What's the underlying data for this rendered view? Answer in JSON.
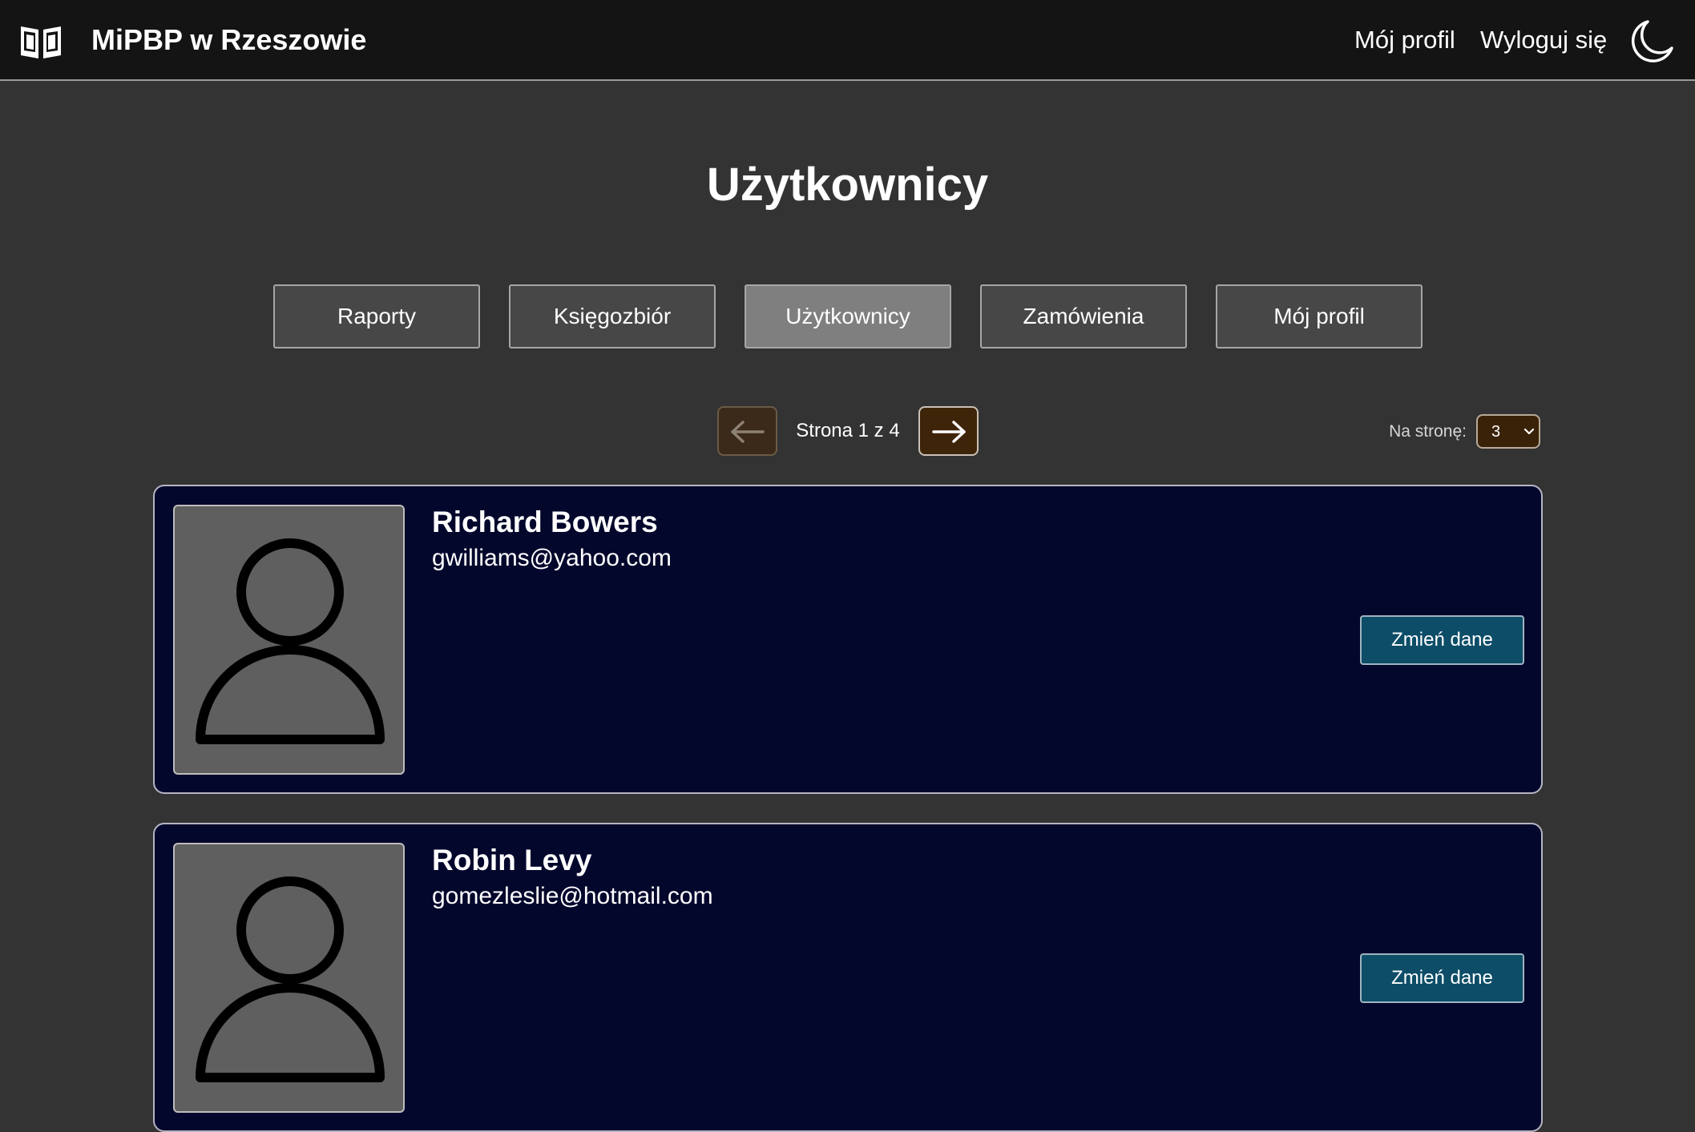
{
  "header": {
    "brand_icon": "open-book-icon",
    "brand_name": "MiPBP w Rzeszowie",
    "profile_link": "Mój profil",
    "logout_link": "Wyloguj się",
    "theme_icon": "moon-icon"
  },
  "page": {
    "title": "Użytkownicy"
  },
  "tabs": [
    {
      "label": "Raporty",
      "active": false
    },
    {
      "label": "Księgozbiór",
      "active": false
    },
    {
      "label": "Użytkownicy",
      "active": true
    },
    {
      "label": "Zamówienia",
      "active": false
    },
    {
      "label": "Mój profil",
      "active": false
    }
  ],
  "pagination": {
    "prev_icon": "arrow-left-icon",
    "next_icon": "arrow-right-icon",
    "page_text": "Strona 1 z 4",
    "per_page_label": "Na stronę:",
    "per_page_value": "3"
  },
  "users": [
    {
      "name": "Richard Bowers",
      "email": "gwilliams@yahoo.com",
      "avatar_icon": "user-avatar-icon",
      "edit_label": "Zmień dane"
    },
    {
      "name": "Robin Levy",
      "email": "gomezleslie@hotmail.com",
      "avatar_icon": "user-avatar-icon",
      "edit_label": "Zmień dane"
    }
  ],
  "colors": {
    "page_bg": "#333333",
    "navbar_bg": "#141414",
    "card_bg": "#04072c",
    "edit_button_bg": "#0d4d68",
    "pagination_bg": "#3e2509",
    "tab_bg": "#474747",
    "tab_active_bg": "#7f7f7f"
  }
}
